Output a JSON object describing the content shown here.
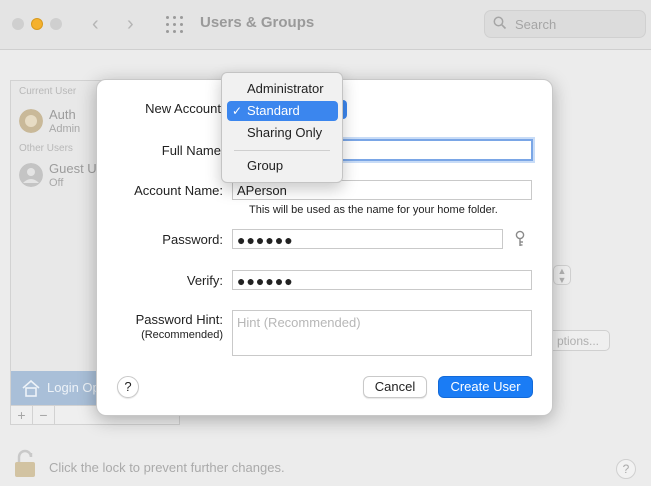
{
  "window": {
    "title": "Users & Groups",
    "search_placeholder": "Search"
  },
  "background": {
    "current_users_label": "Current User",
    "current_user": {
      "name": "Auth",
      "status": "Admin"
    },
    "other_users_label": "Other Users",
    "guest_user": {
      "name": "Guest U",
      "status": "Off"
    },
    "login_options": "Login Op",
    "add": "+",
    "remove": "−",
    "options_button": "ptions...",
    "lock_text": "Click the lock to prevent further changes.",
    "help": "?"
  },
  "sheet": {
    "new_account_label": "New Account",
    "full_name_label": "Full Name",
    "full_name_value": "",
    "account_name_label": "Account Name:",
    "account_name_value": "APerson",
    "account_name_note": "This will be used as the name for your home folder.",
    "password_label": "Password:",
    "password_value": "●●●●●●",
    "verify_label": "Verify:",
    "verify_value": "●●●●●●",
    "hint_label": "Password Hint:",
    "hint_sublabel": "(Recommended)",
    "hint_placeholder": "Hint (Recommended)",
    "help_label": "?",
    "cancel_label": "Cancel",
    "create_label": "Create User"
  },
  "account_type_menu": {
    "items": [
      "Administrator",
      "Standard",
      "Sharing Only",
      "Group"
    ],
    "selected": "Standard",
    "check": "✓"
  },
  "colors": {
    "accent": "#1a7cf5",
    "menu_highlight": "#3b86ee",
    "focus_ring": "#7aa6e6"
  }
}
